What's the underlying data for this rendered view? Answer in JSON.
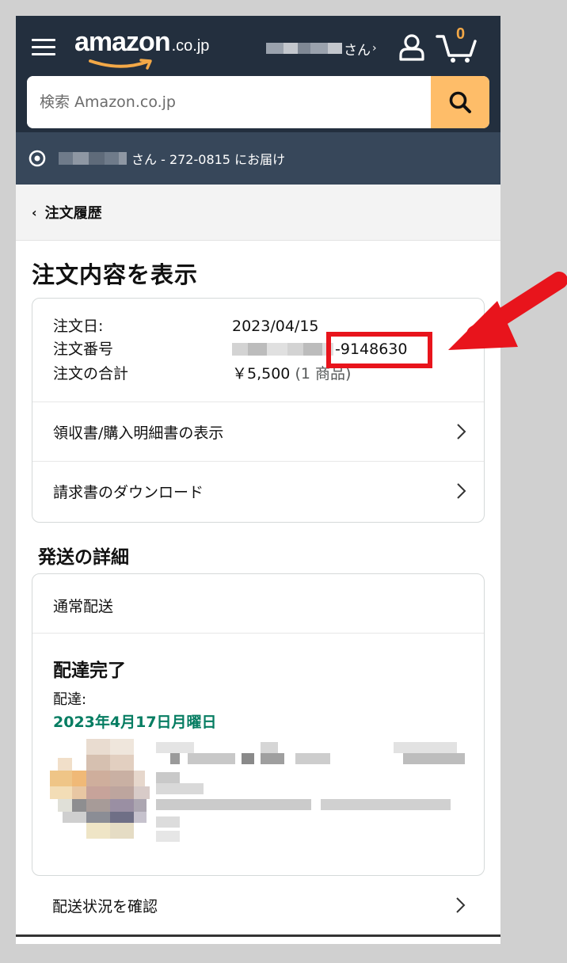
{
  "header": {
    "logo_text": "amazon",
    "logo_tld": ".co.jp",
    "account_suffix": "さん",
    "account_caret": "›",
    "cart_count": "0",
    "brand_color": "#232f3e",
    "accent_color": "#febd69"
  },
  "search": {
    "placeholder": "検索 Amazon.co.jp"
  },
  "delivery": {
    "text": "さん - 272-0815 にお届け"
  },
  "breadcrumb": {
    "arrow": "‹",
    "label": "注文履歴"
  },
  "page_title": "注文内容を表示",
  "order_summary": {
    "date_label": "注文日:",
    "date_value": "2023/04/15",
    "number_label": "注文番号",
    "number_value": "-9148630",
    "total_label": "注文の合計",
    "total_value": "￥5,500",
    "total_count": "(1 商品)"
  },
  "links": {
    "receipt": "領収書/購入明細書の表示",
    "invoice": "請求書のダウンロード"
  },
  "shipping": {
    "section_title": "発送の詳細",
    "method": "通常配送",
    "status": "配達完了",
    "delivered_label": "配達:",
    "delivered_date": "2023年4月17日月曜日",
    "date_color": "#067d62"
  },
  "track": {
    "label": "配送状況を確認"
  },
  "annotation": {
    "color": "#e8141c"
  }
}
